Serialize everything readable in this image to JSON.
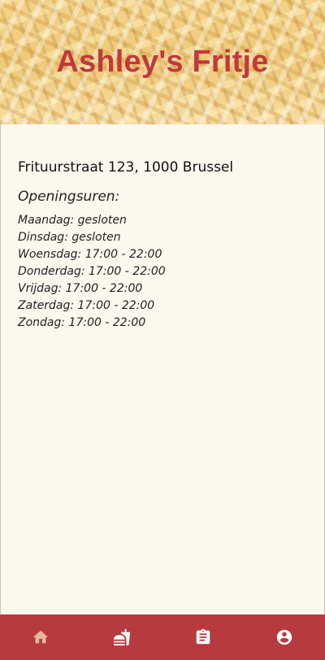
{
  "header": {
    "title": "Ashley's Fritje"
  },
  "info": {
    "address": "Frituurstraat 123, 1000 Brussel",
    "hours_title": "Openingsuren:",
    "hours": [
      "Maandag: gesloten",
      "Dinsdag: gesloten",
      "Woensdag: 17:00 - 22:00",
      "Donderdag: 17:00 - 22:00",
      "Vrijdag: 17:00 - 22:00",
      "Zaterdag: 17:00 - 22:00",
      "Zondag: 17:00 - 22:00"
    ]
  },
  "nav": {
    "items": [
      {
        "icon": "home-icon",
        "active": true
      },
      {
        "icon": "fastfood-icon",
        "active": false
      },
      {
        "icon": "clipboard-icon",
        "active": false
      },
      {
        "icon": "account-icon",
        "active": false
      }
    ]
  },
  "colors": {
    "accent": "#c0393b",
    "nav_background": "#b63a3e",
    "page_background": "#fcf8ee",
    "nav_active_icon": "#e8b89a",
    "nav_icon": "#ffffff"
  }
}
